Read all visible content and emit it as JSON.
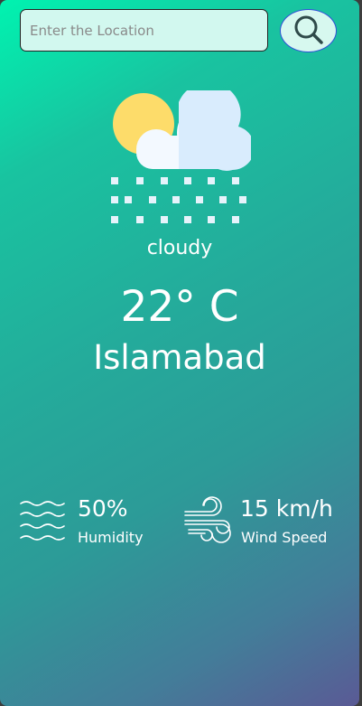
{
  "search": {
    "placeholder": "Enter the Location",
    "value": ""
  },
  "weather": {
    "condition": "cloudy",
    "temperature": "22° C",
    "city": "Islamabad"
  },
  "stats": {
    "humidity_value": "50%",
    "humidity_label": "Humidity",
    "wind_value": "15 km/h",
    "wind_label": "Wind Speed"
  },
  "icons": {
    "search": "search-icon",
    "weather": "cloudy-rain-icon",
    "humidity": "humidity-waves-icon",
    "wind": "wind-icon"
  },
  "colors": {
    "gradient_start": "#00f3b0",
    "gradient_mid": "#2c9b98",
    "gradient_end": "#5a5a95",
    "input_bg": "#d2f8ef",
    "sun": "#fddc6a",
    "cloud": "#f3f9ff"
  }
}
